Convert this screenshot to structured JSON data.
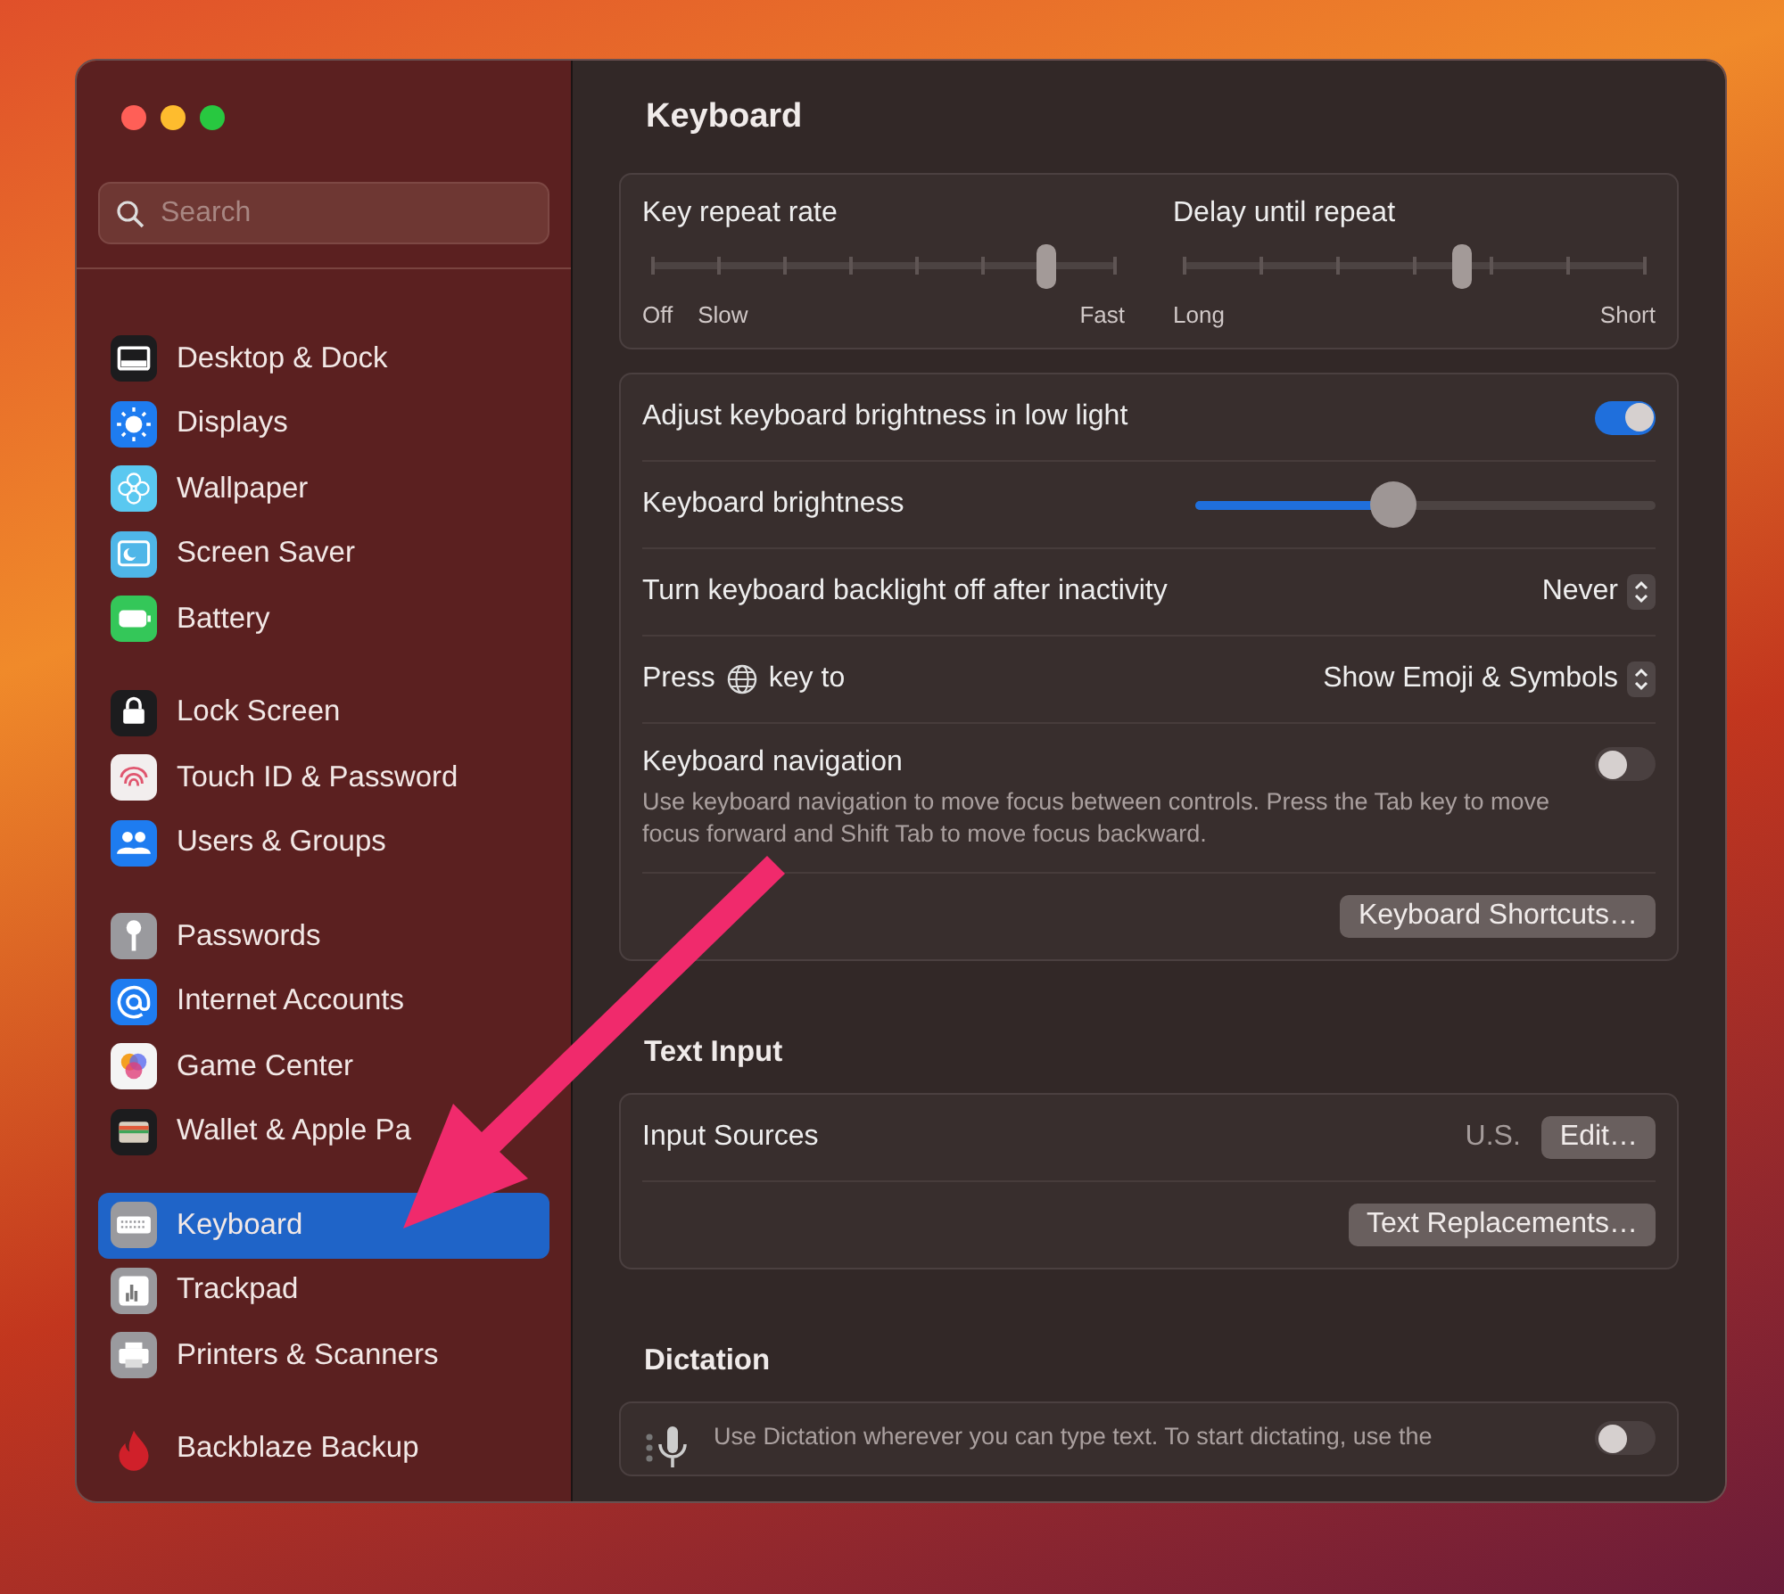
{
  "window": {
    "title": "Keyboard"
  },
  "sidebar": {
    "search": {
      "placeholder": "Search"
    },
    "groups": [
      [
        {
          "label": "Desktop & Dock",
          "selected": false
        },
        {
          "label": "Displays",
          "selected": false
        },
        {
          "label": "Wallpaper",
          "selected": false
        },
        {
          "label": "Screen Saver",
          "selected": false
        },
        {
          "label": "Battery",
          "selected": false
        }
      ],
      [
        {
          "label": "Lock Screen",
          "selected": false
        },
        {
          "label": "Touch ID & Password",
          "selected": false
        },
        {
          "label": "Users & Groups",
          "selected": false
        }
      ],
      [
        {
          "label": "Passwords",
          "selected": false
        },
        {
          "label": "Internet Accounts",
          "selected": false
        },
        {
          "label": "Game Center",
          "selected": false
        },
        {
          "label": "Wallet & Apple Pa",
          "selected": false
        }
      ],
      [
        {
          "label": "Keyboard",
          "selected": true
        },
        {
          "label": "Trackpad",
          "selected": false
        },
        {
          "label": "Printers & Scanners",
          "selected": false
        }
      ],
      [
        {
          "label": "Backblaze Backup",
          "selected": false
        }
      ]
    ]
  },
  "repeat": [
    {
      "label": "Key repeat rate",
      "level": 0.85,
      "ticks_left": [
        "Off",
        "Slow"
      ],
      "tick_right": "Fast"
    },
    {
      "label": "Delay until repeat",
      "level": 0.6,
      "ticks_left": [
        "Long"
      ],
      "tick_right": "Short"
    }
  ],
  "settings": [
    {
      "kind": "toggle",
      "label": "Adjust keyboard brightness in low light",
      "on": true
    },
    {
      "kind": "slider",
      "label": "Keyboard brightness",
      "level": 0.43
    },
    {
      "kind": "popup",
      "label": "Turn keyboard backlight off after inactivity",
      "value": "Never"
    },
    {
      "kind": "globe-popup",
      "label": "Press",
      "label_after": "key to",
      "value": "Show Emoji & Symbols"
    },
    {
      "kind": "toggle",
      "label": "Keyboard navigation",
      "on": false,
      "description": "Use keyboard navigation to move focus between controls. Press the Tab key to move focus forward and Shift Tab to move focus backward."
    },
    {
      "kind": "button",
      "value": "Keyboard Shortcuts…"
    }
  ],
  "text_input": {
    "heading": "Text Input",
    "rows": [
      {
        "kind": "source",
        "label": "Input Sources",
        "value": "U.S.",
        "button": "Edit…"
      },
      {
        "kind": "button",
        "value": "Text Replacements…"
      }
    ]
  },
  "dictation": {
    "heading": "Dictation",
    "description": "Use Dictation wherever you can type text. To start dictating, use the",
    "on": false
  }
}
